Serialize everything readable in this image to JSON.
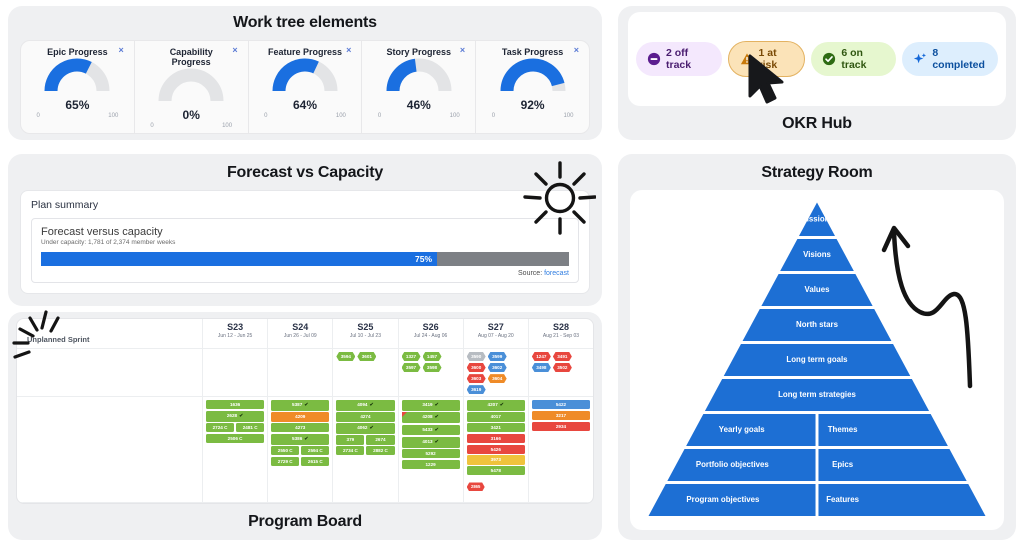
{
  "work_tree": {
    "title": "Work tree elements",
    "gauges": [
      {
        "label": "Epic Progress",
        "value": 65,
        "display": "65%",
        "min": "0",
        "max": "100"
      },
      {
        "label": "Capability Progress",
        "value": 0,
        "display": "0%",
        "min": "0",
        "max": "100"
      },
      {
        "label": "Feature Progress",
        "value": 64,
        "display": "64%",
        "min": "0",
        "max": "100"
      },
      {
        "label": "Story Progress",
        "value": 46,
        "display": "46%",
        "min": "0",
        "max": "100"
      },
      {
        "label": "Task Progress",
        "value": 92,
        "display": "92%",
        "min": "0",
        "max": "100"
      }
    ],
    "close_glyph": "×",
    "accent": "#1a6fe0",
    "track": "#e3e4e6"
  },
  "okr_hub": {
    "title": "OKR Hub",
    "chips": [
      {
        "label": "2 off track",
        "icon": "minus-circle-icon",
        "style": "offtrack"
      },
      {
        "label": "1 at risk",
        "icon": "warning-triangle-icon",
        "style": "atrisk"
      },
      {
        "label": "6 on track",
        "icon": "check-circle-icon",
        "style": "ontrack"
      },
      {
        "label": "8 completed",
        "icon": "sparkle-icon",
        "style": "completed"
      }
    ]
  },
  "forecast": {
    "title": "Forecast vs Capacity",
    "plan_summary_label": "Plan summary",
    "card_title": "Forecast versus capacity",
    "card_sub": "Under capacity: 1,781 of 2,374 member weeks",
    "bar_percent": 75,
    "bar_label": "75%",
    "source_prefix": "Source:",
    "source_link": "forecast",
    "bar_fill_color": "#1a6fe0",
    "bar_track_color": "#7d8085"
  },
  "program_board": {
    "title": "Program Board",
    "row_label": "Unplanned Sprint",
    "sprints": [
      {
        "name": "S23",
        "dates": "Jun 12 - Jun 25"
      },
      {
        "name": "S24",
        "dates": "Jun 26 - Jul 09"
      },
      {
        "name": "S25",
        "dates": "Jul 10 - Jul 23"
      },
      {
        "name": "S26",
        "dates": "Jul 24 - Aug 06"
      },
      {
        "name": "S27",
        "dates": "Aug 07 - Aug 20"
      },
      {
        "name": "S28",
        "dates": "Aug 21 - Sep 03"
      }
    ],
    "unplanned": [
      [],
      [],
      [
        {
          "id": "3594",
          "c": "green"
        },
        {
          "id": "3601",
          "c": "green"
        }
      ],
      [
        {
          "id": "1327",
          "c": "green"
        },
        {
          "id": "1457",
          "c": "green"
        },
        {
          "id": "3597",
          "c": "green"
        },
        {
          "id": "3598",
          "c": "green"
        }
      ],
      [
        {
          "id": "3590",
          "c": "grey"
        },
        {
          "id": "3599",
          "c": "blue"
        },
        {
          "id": "3600",
          "c": "red"
        },
        {
          "id": "3602",
          "c": "blue"
        },
        {
          "id": "3603",
          "c": "red"
        },
        {
          "id": "3604",
          "c": "orange"
        },
        {
          "id": "3619",
          "c": "blue"
        }
      ],
      [
        {
          "id": "1247",
          "c": "red"
        },
        {
          "id": "3491",
          "c": "red"
        },
        {
          "id": "3498",
          "c": "blue"
        },
        {
          "id": "3502",
          "c": "red"
        }
      ]
    ],
    "planned": [
      {
        "cards": [
          {
            "id": "1636",
            "c": "green"
          },
          {
            "id": "2628",
            "c": "green",
            "tick": true
          }
        ],
        "pairs": [
          [
            "2724 C",
            "2481 C"
          ],
          [
            "2506 C"
          ]
        ]
      },
      {
        "cards": [
          {
            "id": "5387",
            "c": "green",
            "tick": true
          },
          {
            "id": "4209",
            "c": "orange"
          },
          {
            "id": "4273",
            "c": "green"
          },
          {
            "id": "5386",
            "c": "green",
            "tick": true
          }
        ],
        "pairs": [
          [
            "2550 C",
            "2594 C"
          ],
          [
            "2729 C",
            "2615 C"
          ]
        ]
      },
      {
        "cards": [
          {
            "id": "4094",
            "c": "green",
            "tick": true
          },
          {
            "id": "4274",
            "c": "green"
          },
          {
            "id": "4062",
            "c": "green",
            "tick": true
          }
        ],
        "pairs": [
          [
            "379",
            "2674"
          ],
          [
            "2734 C",
            "2882 C"
          ]
        ]
      },
      {
        "cards": [
          {
            "id": "3419",
            "c": "green",
            "tick": true
          },
          {
            "id": "4208",
            "c": "green",
            "tick": true,
            "flag": true
          },
          {
            "id": "5433",
            "c": "green",
            "tick": true
          },
          {
            "id": "4013",
            "c": "green",
            "tick": true
          },
          {
            "id": "5292",
            "c": "green"
          }
        ],
        "pairs": [
          [
            "1229"
          ]
        ]
      },
      {
        "cards": [
          {
            "id": "4207",
            "c": "green",
            "tick": true
          },
          {
            "id": "4017",
            "c": "green"
          },
          {
            "id": "3421",
            "c": "green"
          },
          {
            "id": "3166",
            "c": "red"
          },
          {
            "id": "5426",
            "c": "red"
          },
          {
            "id": "3973",
            "c": "yellow"
          },
          {
            "id": "5478",
            "c": "green"
          }
        ],
        "hex": [
          {
            "id": "2865",
            "c": "red"
          }
        ],
        "pairs": []
      },
      {
        "cards": [
          {
            "id": "5422",
            "c": "blue"
          },
          {
            "id": "3217",
            "c": "orange"
          },
          {
            "id": "2934",
            "c": "red"
          }
        ],
        "pairs": []
      }
    ],
    "colors": {
      "green": "#7bbb42",
      "orange": "#ef8b28",
      "red": "#e8473f",
      "blue": "#4a8fd8",
      "grey": "#b7bcc2",
      "yellow": "#efc33c"
    }
  },
  "strategy": {
    "title": "Strategy Room",
    "levels": [
      {
        "label": "Missions"
      },
      {
        "label": "Visions"
      },
      {
        "label": "Values"
      },
      {
        "label": "North stars"
      },
      {
        "label": "Long term goals"
      },
      {
        "label": "Long term strategies"
      },
      {
        "label": "Yearly goals",
        "right": "Themes"
      },
      {
        "label": "Portfolio objectives",
        "right": "Epics"
      },
      {
        "label": "Program objectives",
        "right": "Features"
      }
    ],
    "fill": "#1d6fd4"
  }
}
